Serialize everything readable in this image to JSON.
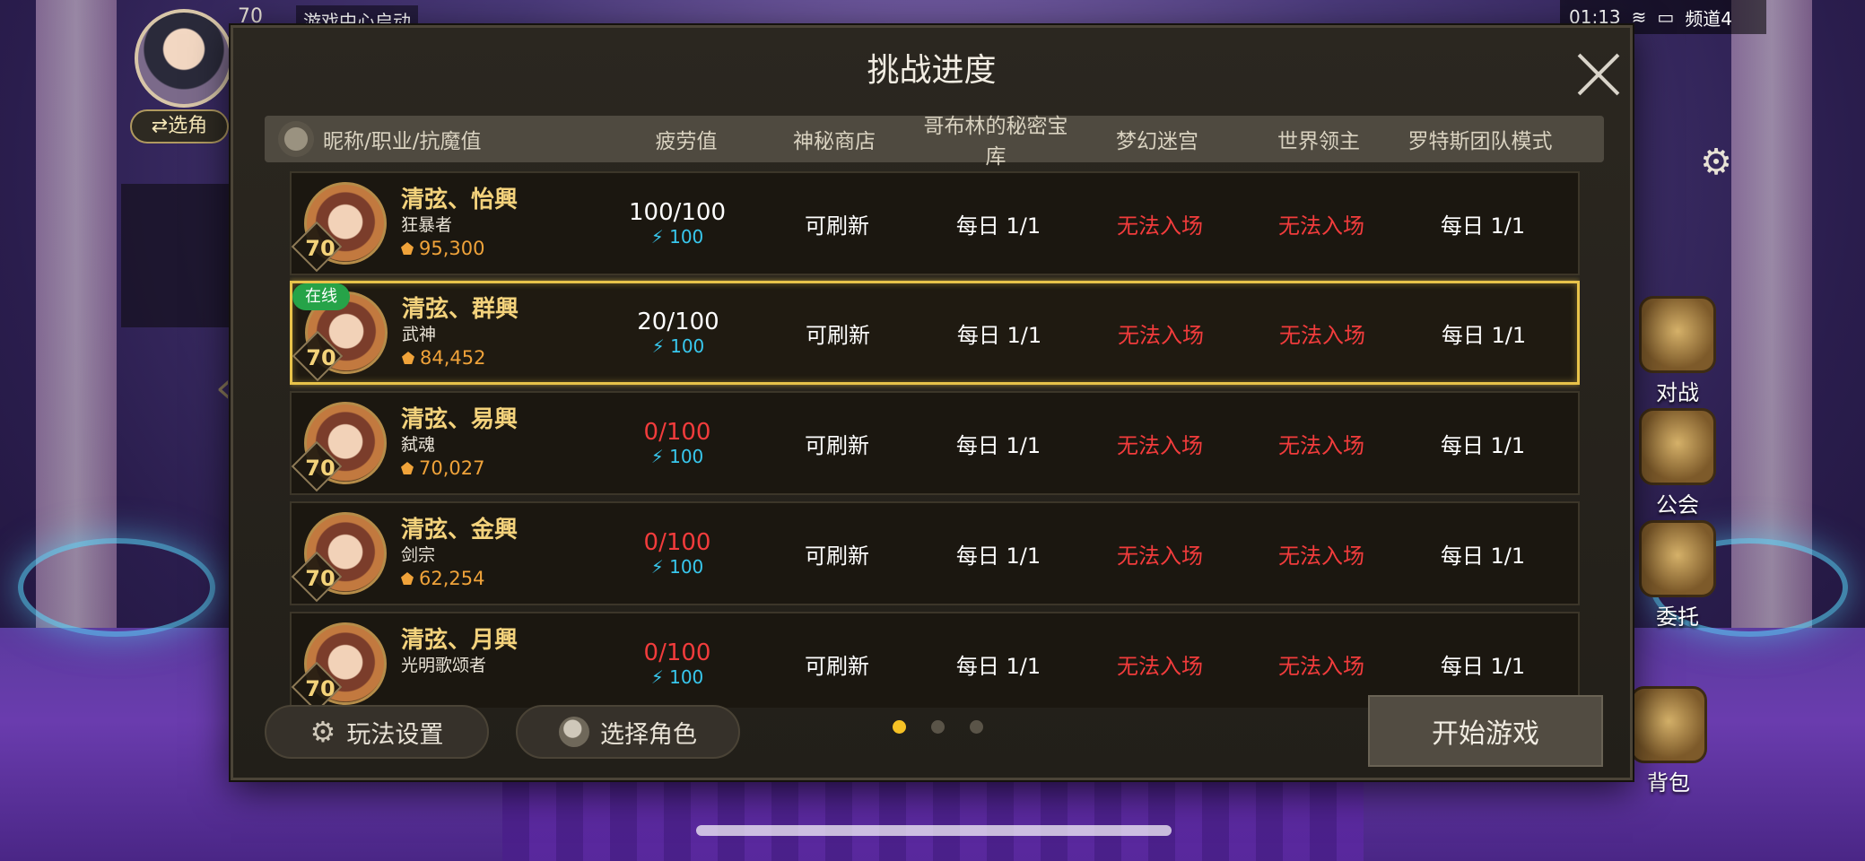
{
  "hud": {
    "level": "70",
    "center_text": "游戏中心启动",
    "switch_role": "⇄选角",
    "time": "01:13",
    "channel": "频道4",
    "side_buttons": [
      "对战",
      "公会",
      "委托",
      "背包"
    ]
  },
  "modal": {
    "title": "挑战进度",
    "headers": {
      "name": "昵称/职业/抗魔值",
      "fatigue": "疲劳值",
      "shop": "神秘商店",
      "goblin": "哥布林的秘密宝库",
      "maze": "梦幻迷宫",
      "boss": "世界领主",
      "rotes": "罗特斯团队模式"
    },
    "rows": [
      {
        "name": "清弦、怡興",
        "class": "狂暴者",
        "power": "95,300",
        "level": "70",
        "online": "",
        "fatigue": "100/100",
        "fatigue_red": false,
        "energy": "100",
        "shop": "可刷新",
        "goblin": "每日 1/1",
        "maze": "无法入场",
        "boss": "无法入场",
        "rotes": "每日 1/1",
        "selected": false
      },
      {
        "name": "清弦、群興",
        "class": "武神",
        "power": "84,452",
        "level": "70",
        "online": "在线",
        "fatigue": "20/100",
        "fatigue_red": false,
        "energy": "100",
        "shop": "可刷新",
        "goblin": "每日 1/1",
        "maze": "无法入场",
        "boss": "无法入场",
        "rotes": "每日 1/1",
        "selected": true
      },
      {
        "name": "清弦、易興",
        "class": "弑魂",
        "power": "70,027",
        "level": "70",
        "online": "",
        "fatigue": "0/100",
        "fatigue_red": true,
        "energy": "100",
        "shop": "可刷新",
        "goblin": "每日 1/1",
        "maze": "无法入场",
        "boss": "无法入场",
        "rotes": "每日 1/1",
        "selected": false
      },
      {
        "name": "清弦、金興",
        "class": "剑宗",
        "power": "62,254",
        "level": "70",
        "online": "",
        "fatigue": "0/100",
        "fatigue_red": true,
        "energy": "100",
        "shop": "可刷新",
        "goblin": "每日 1/1",
        "maze": "无法入场",
        "boss": "无法入场",
        "rotes": "每日 1/1",
        "selected": false
      },
      {
        "name": "清弦、月興",
        "class": "光明歌颂者",
        "power": "",
        "level": "70",
        "online": "",
        "fatigue": "0/100",
        "fatigue_red": true,
        "energy": "100",
        "shop": "可刷新",
        "goblin": "每日 1/1",
        "maze": "无法入场",
        "boss": "无法入场",
        "rotes": "每日 1/1",
        "selected": false
      }
    ],
    "buttons": {
      "settings": "玩法设置",
      "select_role": "选择角色",
      "start": "开始游戏"
    },
    "pages": {
      "total": 3,
      "current": 1
    }
  }
}
